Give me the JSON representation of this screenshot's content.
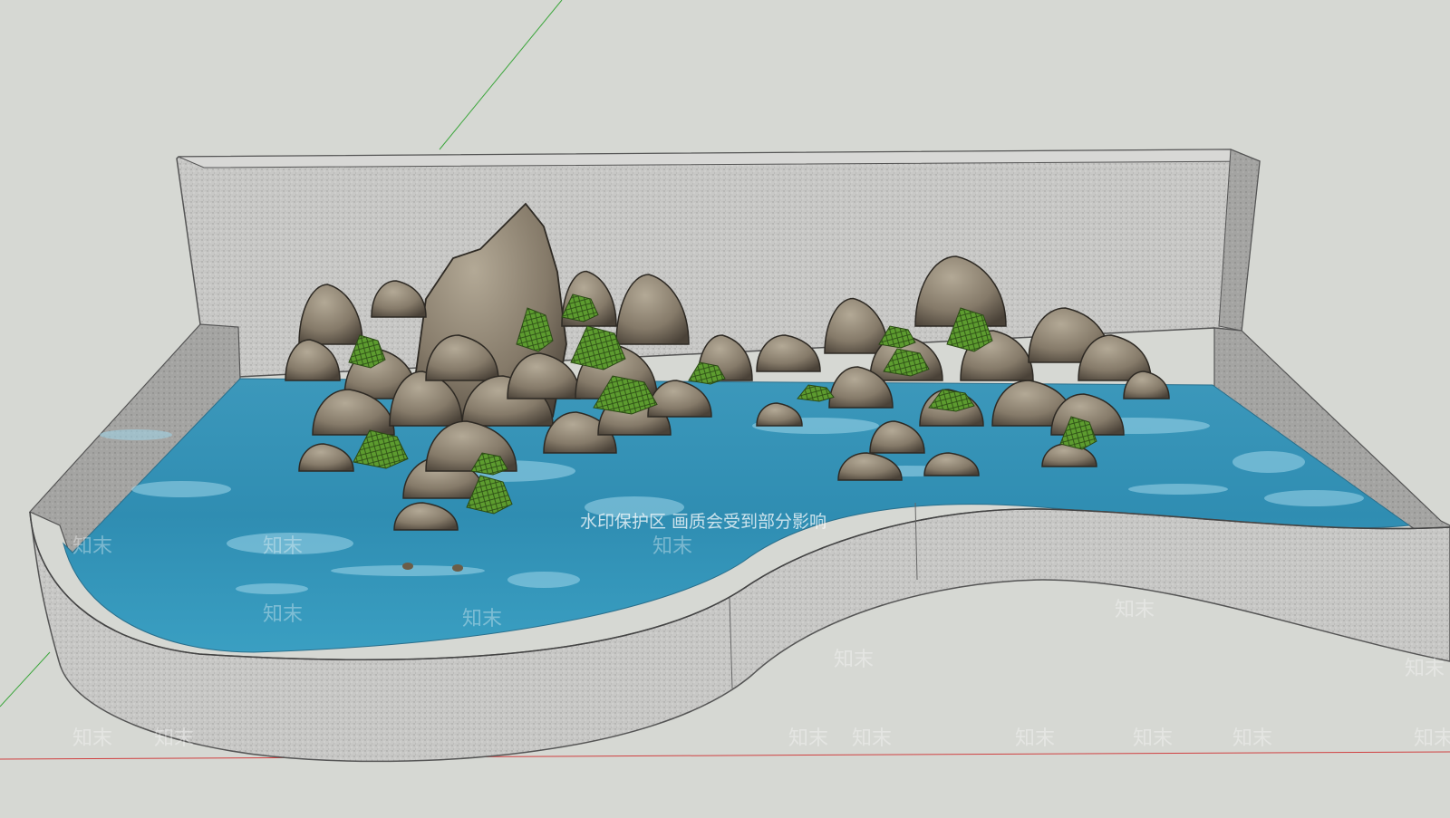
{
  "viewport": {
    "background": "#d6d8d3",
    "ground_color": "#d3d4d0",
    "axis_colors": {
      "green": "#3da63d",
      "red": "#d04040"
    }
  },
  "model": {
    "wall_color": "#c9c9c7",
    "stone_texture_dark": "#9a9a98",
    "water_color": "#2f8fb2",
    "water_light": "#7fc4dd",
    "rock_color": "#8c8272",
    "rock_dark": "#3b352d",
    "planting_color": "#5a9a2e"
  },
  "watermark": {
    "notice": "水印保护区  画质会受到部分影响",
    "brand": "知末",
    "brand_count": 16
  }
}
